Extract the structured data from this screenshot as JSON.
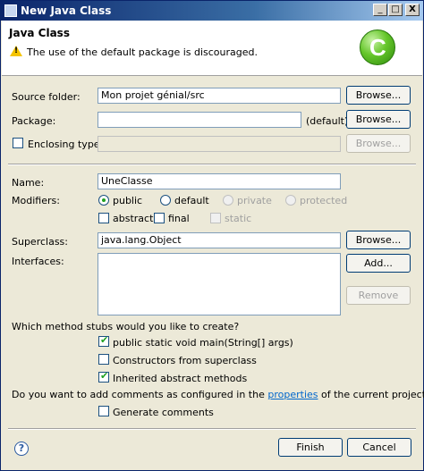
{
  "window": {
    "title": "New Java Class",
    "controls": {
      "minimize": "_",
      "maximize": "□",
      "close": "X"
    }
  },
  "header": {
    "title": "Java Class",
    "message": "The use of the default package is discouraged."
  },
  "source_folder": {
    "label": "Source folder:",
    "value": "Mon projet génial/src",
    "browse": "Browse..."
  },
  "package": {
    "label": "Package:",
    "value": "",
    "suffix": "(default)",
    "browse": "Browse..."
  },
  "enclosing": {
    "label": "Enclosing type:",
    "value": "",
    "browse": "Browse..."
  },
  "name": {
    "label": "Name:",
    "value": "UneClasse"
  },
  "modifiers": {
    "label": "Modifiers:",
    "access": [
      "public",
      "default",
      "private",
      "protected"
    ],
    "selected_access": "public",
    "extra": [
      "abstract",
      "final",
      "static"
    ]
  },
  "superclass": {
    "label": "Superclass:",
    "value": "java.lang.Object",
    "browse": "Browse..."
  },
  "interfaces": {
    "label": "Interfaces:",
    "add": "Add...",
    "remove": "Remove"
  },
  "stubs": {
    "question": "Which method stubs would you like to create?",
    "options": [
      {
        "label": "public static void main(String[] args)",
        "checked": true
      },
      {
        "label": "Constructors from superclass",
        "checked": false
      },
      {
        "label": "Inherited abstract methods",
        "checked": true
      }
    ]
  },
  "comments": {
    "question_pre": "Do you want to add comments as configured in the ",
    "link": "properties",
    "question_post": " of the current project?",
    "generate": "Generate comments",
    "checked": false
  },
  "footer": {
    "help": "?",
    "finish": "Finish",
    "cancel": "Cancel"
  }
}
